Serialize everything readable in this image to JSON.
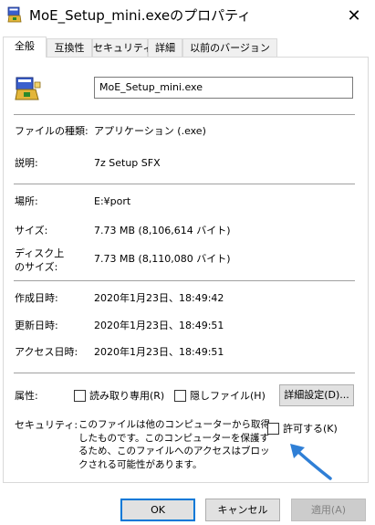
{
  "window": {
    "title": "MoE_Setup_mini.exeのプロパティ",
    "close_glyph": "✕"
  },
  "tabs": [
    {
      "label": "全般",
      "active": true
    },
    {
      "label": "互換性",
      "active": false
    },
    {
      "label": "セキュリティ",
      "active": false
    },
    {
      "label": "詳細",
      "active": false
    },
    {
      "label": "以前のバージョン",
      "active": false
    }
  ],
  "general": {
    "filename": "MoE_Setup_mini.exe",
    "file_type_label": "ファイルの種類:",
    "file_type_value": "アプリケーション (.exe)",
    "description_label": "説明:",
    "description_value": "7z Setup SFX",
    "location_label": "場所:",
    "location_value": "E:¥port",
    "size_label": "サイズ:",
    "size_value": "7.73 MB (8,106,614 バイト)",
    "disk_size_label_line1": "ディスク上",
    "disk_size_label_line2": "のサイズ:",
    "disk_size_value": "7.73 MB (8,110,080 バイト)",
    "created_label": "作成日時:",
    "created_value": "2020年1月23日、18:49:42",
    "modified_label": "更新日時:",
    "modified_value": "2020年1月23日、18:49:51",
    "accessed_label": "アクセス日時:",
    "accessed_value": "2020年1月23日、18:49:51",
    "attributes_label": "属性:",
    "readonly_label": "読み取り専用(R)",
    "readonly_checked": false,
    "hidden_label": "隠しファイル(H)",
    "hidden_checked": false,
    "advanced_button": "詳細設定(D)...",
    "security_label": "セキュリティ:",
    "security_text": "このファイルは他のコンピューターから取得したものです。このコンピューターを保護するため、このファイルへのアクセスはブロックされる可能性があります。",
    "unblock_label": "許可する(K)",
    "unblock_checked": false
  },
  "footer": {
    "ok_label": "OK",
    "cancel_label": "キャンセル",
    "apply_label": "適用(A)",
    "apply_enabled": false
  },
  "annotation": {
    "arrow_color": "#2f7fd6"
  },
  "colors": {
    "accent": "#0078d7",
    "panel_border": "#d9d9d9"
  }
}
